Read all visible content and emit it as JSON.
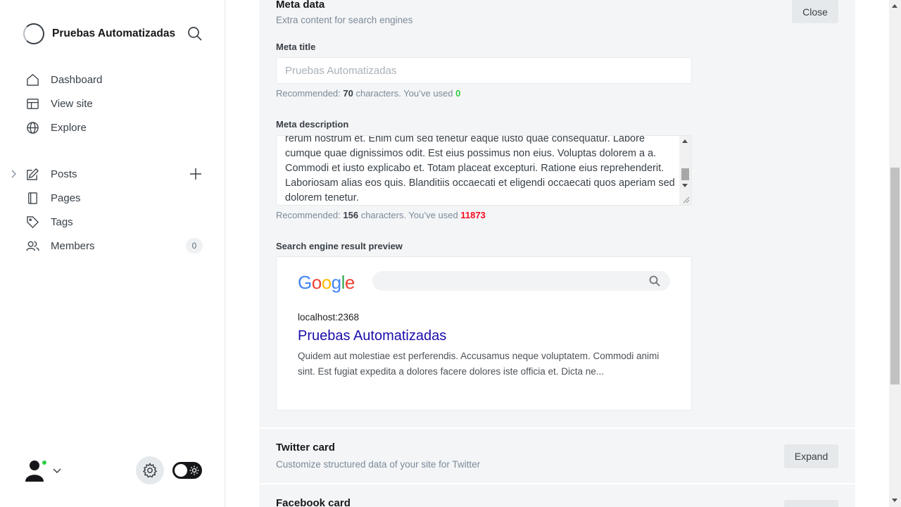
{
  "sidebar": {
    "site_name": "Pruebas Automatizadas",
    "nav_primary": [
      {
        "label": "Dashboard",
        "icon": "home-icon"
      },
      {
        "label": "View site",
        "icon": "layout-icon"
      },
      {
        "label": "Explore",
        "icon": "globe-icon"
      }
    ],
    "nav_content": [
      {
        "label": "Posts",
        "icon": "pencil-icon"
      },
      {
        "label": "Pages",
        "icon": "page-icon"
      },
      {
        "label": "Tags",
        "icon": "tag-icon"
      },
      {
        "label": "Members",
        "icon": "members-icon",
        "count": "0"
      }
    ]
  },
  "meta": {
    "title": "Meta data",
    "subtitle": "Extra content for search engines",
    "close_label": "Close",
    "meta_title_label": "Meta title",
    "meta_title_placeholder": "Pruebas Automatizadas",
    "meta_title_hint": {
      "prefix": "Recommended: ",
      "recommended": "70",
      "middle": " characters. You’ve used ",
      "used": "0"
    },
    "meta_description_label": "Meta description",
    "meta_description_text": "rerum nostrum et. Enim cum sed tenetur eaque iusto quae consequatur. Labore cumque quae dignissimos odit. Est eius possimus non eius. Voluptas dolorem a a. Commodi et iusto explicabo et. Totam placeat excepturi. Ratione eius reprehenderit. Laboriosam alias eos quis. Blanditiis occaecati et eligendi occaecati quos aperiam sed dolorem tenetur.",
    "meta_description_hint": {
      "prefix": "Recommended: ",
      "recommended": "156",
      "middle": " characters. You’ve used ",
      "used": "11873"
    },
    "preview_label": "Search engine result preview"
  },
  "serp_preview": {
    "logo": "Google",
    "url": "localhost:2368",
    "title": "Pruebas Automatizadas",
    "description": "Quidem aut molestiae est perferendis. Accusamus neque voluptatem. Commodi animi sint. Est fugiat expedita a dolores facere dolores iste officia et. Dicta ne..."
  },
  "twitter": {
    "title": "Twitter card",
    "subtitle": "Customize structured data of your site for Twitter",
    "expand_label": "Expand"
  },
  "facebook": {
    "title": "Facebook card"
  },
  "colors": {
    "accent_green": "#30cf43",
    "accent_red": "#f50b23",
    "serp_link": "#1a0dab"
  }
}
